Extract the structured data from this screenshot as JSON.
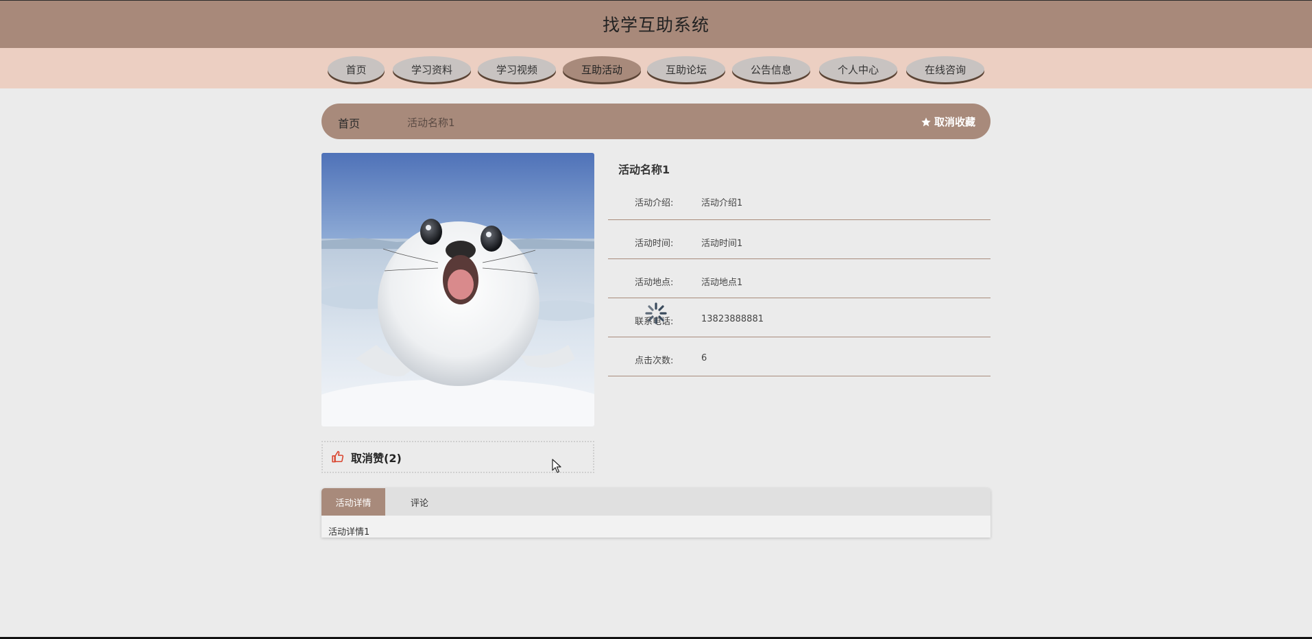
{
  "header": {
    "title": "找学互助系统"
  },
  "nav": {
    "items": [
      {
        "label": "首页"
      },
      {
        "label": "学习资料"
      },
      {
        "label": "学习视频"
      },
      {
        "label": "互助活动"
      },
      {
        "label": "互助论坛"
      },
      {
        "label": "公告信息"
      },
      {
        "label": "个人中心"
      },
      {
        "label": "在线咨询"
      }
    ],
    "active": "互助活动"
  },
  "breadcrumb": {
    "home": "首页",
    "current": "活动名称1",
    "favorite_label": "取消收藏",
    "favorite_icon": "star-icon"
  },
  "detail": {
    "image_alt": "seal-photo",
    "title": "活动名称1",
    "fields": [
      {
        "key": "活动介绍:",
        "value": "活动介绍1"
      },
      {
        "key": "活动时间:",
        "value": "活动时间1"
      },
      {
        "key": "活动地点:",
        "value": "活动地点1"
      },
      {
        "key": "联系电话:",
        "value": "13823888881"
      },
      {
        "key": "点击次数:",
        "value": "6"
      }
    ]
  },
  "like": {
    "label": "取消赞(2)",
    "icon": "thumbs-up-icon"
  },
  "tabs": {
    "items": [
      {
        "label": "活动详情"
      },
      {
        "label": "评论"
      }
    ],
    "active": "活动详情",
    "content": "活动详情1"
  },
  "colors": {
    "header_bg": "#a8897a",
    "nav_bg": "#eccfc2",
    "accent": "#a88a7b",
    "page_bg": "#ebebeb",
    "nav_button": "#c8c3c1"
  }
}
